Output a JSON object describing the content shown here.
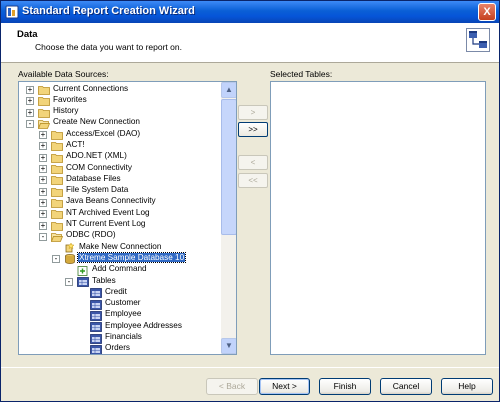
{
  "window": {
    "title": "Standard Report Creation Wizard",
    "close_label": "X"
  },
  "header": {
    "title": "Data",
    "description": "Choose the data you want to report on."
  },
  "left": {
    "label": "Available Data Sources:"
  },
  "right": {
    "label": "Selected Tables:"
  },
  "move_buttons": {
    "add": ">",
    "add_all": ">>",
    "remove": "<",
    "remove_all": "<<"
  },
  "tree": [
    {
      "label": "Current Connections",
      "level": 0,
      "expander": "+",
      "icon": "folder-icon"
    },
    {
      "label": "Favorites",
      "level": 0,
      "expander": "+",
      "icon": "folder-icon"
    },
    {
      "label": "History",
      "level": 0,
      "expander": "+",
      "icon": "folder-icon"
    },
    {
      "label": "Create New Connection",
      "level": 0,
      "expander": "-",
      "icon": "open-folder-icon"
    },
    {
      "label": "Access/Excel (DAO)",
      "level": 1,
      "expander": "+",
      "icon": "folder-icon"
    },
    {
      "label": "ACT!",
      "level": 1,
      "expander": "+",
      "icon": "folder-icon"
    },
    {
      "label": "ADO.NET (XML)",
      "level": 1,
      "expander": "+",
      "icon": "folder-icon"
    },
    {
      "label": "COM Connectivity",
      "level": 1,
      "expander": "+",
      "icon": "folder-icon"
    },
    {
      "label": "Database Files",
      "level": 1,
      "expander": "+",
      "icon": "folder-icon"
    },
    {
      "label": "File System Data",
      "level": 1,
      "expander": "+",
      "icon": "folder-icon"
    },
    {
      "label": "Java Beans Connectivity",
      "level": 1,
      "expander": "+",
      "icon": "folder-icon"
    },
    {
      "label": "NT Archived Event Log",
      "level": 1,
      "expander": "+",
      "icon": "folder-icon"
    },
    {
      "label": "NT Current Event Log",
      "level": 1,
      "expander": "+",
      "icon": "folder-icon"
    },
    {
      "label": "ODBC (RDO)",
      "level": 1,
      "expander": "-",
      "icon": "open-folder-icon"
    },
    {
      "label": "Make New Connection",
      "level": 2,
      "expander": "",
      "icon": "new-connection-icon"
    },
    {
      "label": "Xtreme Sample Database 10",
      "level": 2,
      "expander": "-",
      "icon": "database-icon",
      "selected": true
    },
    {
      "label": "Add Command",
      "level": 3,
      "expander": "",
      "icon": "add-command-icon"
    },
    {
      "label": "Tables",
      "level": 3,
      "expander": "-",
      "icon": "table-icon"
    },
    {
      "label": "Credit",
      "level": 4,
      "expander": "",
      "icon": "table-icon"
    },
    {
      "label": "Customer",
      "level": 4,
      "expander": "",
      "icon": "table-icon"
    },
    {
      "label": "Employee",
      "level": 4,
      "expander": "",
      "icon": "table-icon"
    },
    {
      "label": "Employee Addresses",
      "level": 4,
      "expander": "",
      "icon": "table-icon"
    },
    {
      "label": "Financials",
      "level": 4,
      "expander": "",
      "icon": "table-icon"
    },
    {
      "label": "Orders",
      "level": 4,
      "expander": "",
      "icon": "table-icon"
    }
  ],
  "buttons": {
    "back": "< Back",
    "next": "Next >",
    "finish": "Finish",
    "cancel": "Cancel",
    "help": "Help"
  },
  "colors": {
    "selection": "#316ac5",
    "titlebar": "#0a5fd6",
    "dialog": "#ece9d8"
  }
}
